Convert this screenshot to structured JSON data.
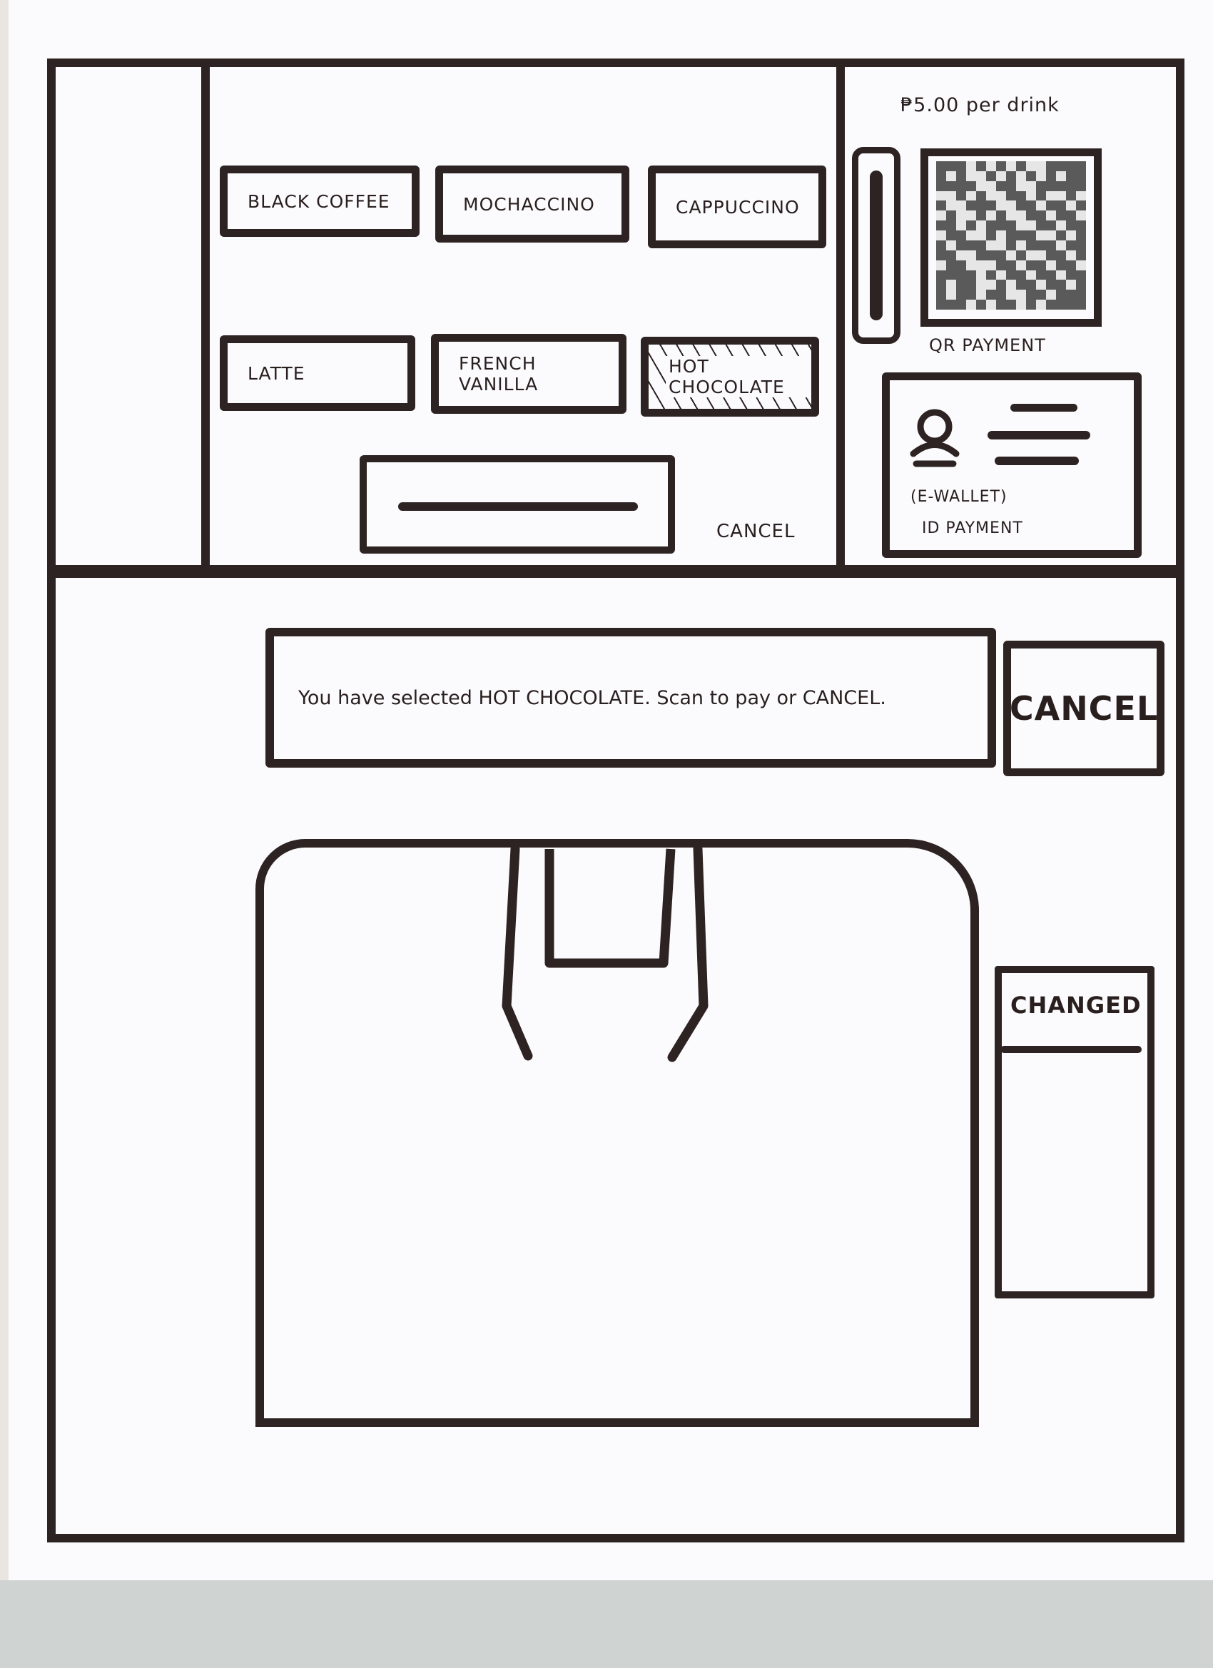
{
  "drinks": {
    "row1": [
      {
        "label": "BLACK COFFEE"
      },
      {
        "label": "MOCHACCINO"
      },
      {
        "label": "CAPPUCCINO"
      }
    ],
    "row2": [
      {
        "label": "LATTE"
      },
      {
        "label": "FRENCH VANILLA"
      },
      {
        "label": "HOT CHOCOLATE",
        "selected": true
      }
    ],
    "cancel_label": "CANCEL"
  },
  "payment": {
    "price": "₱5.00 per drink",
    "qr_label": "QR PAYMENT",
    "ewallet_label": "(E-WALLET)",
    "id_label": "ID PAYMENT"
  },
  "status": {
    "message": "You have selected HOT CHOCOLATE. Scan to pay or CANCEL.",
    "cancel_button": "CANCEL"
  },
  "change_slot": {
    "label": "CHANGED"
  },
  "colors": {
    "ink": "#2e2323",
    "paper": "#fbfbfd"
  }
}
